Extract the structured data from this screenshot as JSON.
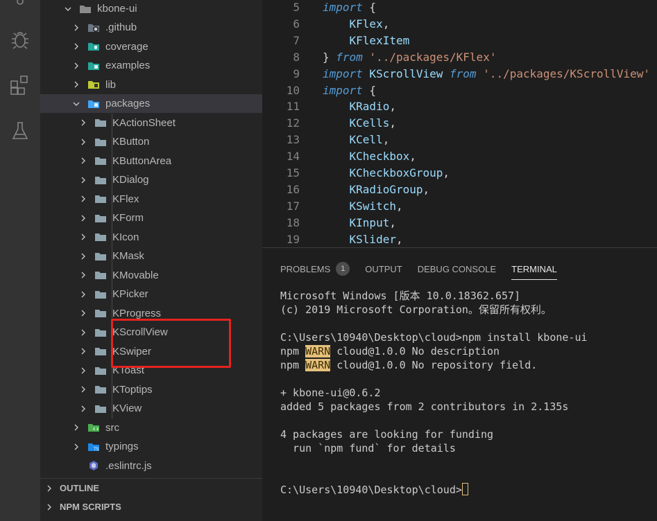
{
  "activity_bar": {
    "icons": [
      "source-control-icon",
      "debug-icon",
      "extensions-icon",
      "test-flask-icon"
    ]
  },
  "explorer": {
    "root": {
      "label": "kbone-ui",
      "expanded": true
    },
    "items": [
      {
        "label": ".github",
        "icon": "github-folder-icon"
      },
      {
        "label": "coverage",
        "icon": "coverage-folder-icon"
      },
      {
        "label": "examples",
        "icon": "examples-folder-icon"
      },
      {
        "label": "lib",
        "icon": "lib-folder-icon"
      },
      {
        "label": "packages",
        "icon": "packages-folder-icon",
        "expanded": true,
        "selected": true
      }
    ],
    "packages": [
      "KActionSheet",
      "KButton",
      "KButtonArea",
      "KDialog",
      "KFlex",
      "KForm",
      "KIcon",
      "KMask",
      "KMovable",
      "KPicker",
      "KProgress",
      "KScrollView",
      "KSwiper",
      "KToast",
      "KToptips",
      "KView"
    ],
    "after_items": [
      {
        "label": "src",
        "icon": "src-folder-icon"
      },
      {
        "label": "typings",
        "icon": "typings-folder-icon"
      },
      {
        "label": ".eslintrc.js",
        "icon": "eslint-file-icon"
      }
    ],
    "sections": [
      "OUTLINE",
      "NPM SCRIPTS"
    ],
    "highlight_color": "#e5231e"
  },
  "editor": {
    "lines": [
      {
        "n": "5",
        "kind": "import_open",
        "a": "import",
        "b": "{"
      },
      {
        "n": "6",
        "kind": "member",
        "a": "KFlex",
        "b": ","
      },
      {
        "n": "7",
        "kind": "member",
        "a": "KFlexItem",
        "b": ""
      },
      {
        "n": "8",
        "kind": "close_from",
        "a": "}",
        "b": "from",
        "c": "'../packages/KFlex'"
      },
      {
        "n": "9",
        "kind": "import_from",
        "a": "import",
        "b": "KScrollView",
        "c": "from",
        "d": "'../packages/KScrollView'"
      },
      {
        "n": "10",
        "kind": "import_open",
        "a": "import",
        "b": "{"
      },
      {
        "n": "11",
        "kind": "member",
        "a": "KRadio",
        "b": ","
      },
      {
        "n": "12",
        "kind": "member",
        "a": "KCells",
        "b": ","
      },
      {
        "n": "13",
        "kind": "member",
        "a": "KCell",
        "b": ","
      },
      {
        "n": "14",
        "kind": "member",
        "a": "KCheckbox",
        "b": ","
      },
      {
        "n": "15",
        "kind": "member",
        "a": "KCheckboxGroup",
        "b": ","
      },
      {
        "n": "16",
        "kind": "member",
        "a": "KRadioGroup",
        "b": ","
      },
      {
        "n": "17",
        "kind": "member",
        "a": "KSwitch",
        "b": ","
      },
      {
        "n": "18",
        "kind": "member",
        "a": "KInput",
        "b": ","
      },
      {
        "n": "19",
        "kind": "member",
        "a": "KSlider",
        "b": ","
      }
    ]
  },
  "panel": {
    "tabs": [
      {
        "label": "PROBLEMS",
        "badge": "1"
      },
      {
        "label": "OUTPUT"
      },
      {
        "label": "DEBUG CONSOLE"
      },
      {
        "label": "TERMINAL",
        "active": true
      }
    ],
    "terminal": [
      {
        "text": "Microsoft Windows [版本 10.0.18362.657]"
      },
      {
        "text": "(c) 2019 Microsoft Corporation。保留所有权利。"
      },
      {
        "text": ""
      },
      {
        "text": "C:\\Users\\10940\\Desktop\\cloud>npm install kbone-ui"
      },
      {
        "pre": "npm ",
        "warn": "WARN",
        "post": " cloud@1.0.0 No description"
      },
      {
        "pre": "npm ",
        "warn": "WARN",
        "post": " cloud@1.0.0 No repository field."
      },
      {
        "text": ""
      },
      {
        "text": "+ kbone-ui@0.6.2"
      },
      {
        "text": "added 5 packages from 2 contributors in 2.135s"
      },
      {
        "text": ""
      },
      {
        "text": "4 packages are looking for funding"
      },
      {
        "text": "  run `npm fund` for details"
      },
      {
        "text": ""
      },
      {
        "text": ""
      },
      {
        "prompt": "C:\\Users\\10940\\Desktop\\cloud>"
      }
    ]
  }
}
